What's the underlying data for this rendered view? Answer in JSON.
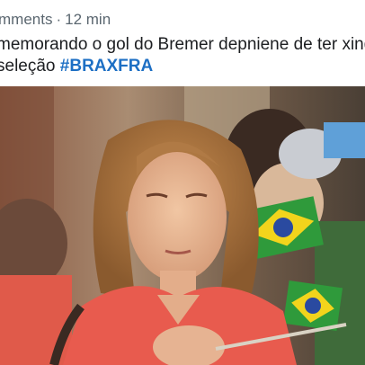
{
  "post": {
    "header": {
      "source": "mments",
      "separator": "·",
      "time": "12 min"
    },
    "text": {
      "line1": "memorando o gol do Bremer depniene de ter xing",
      "line2_prefix": "seleção ",
      "hashtag": "#BRAXFRA"
    },
    "media": {
      "kind": "meme-photo"
    },
    "colors": {
      "meta": "#5b6770",
      "text": "#1c1e21",
      "hashtag": "#1d6fc4"
    }
  }
}
